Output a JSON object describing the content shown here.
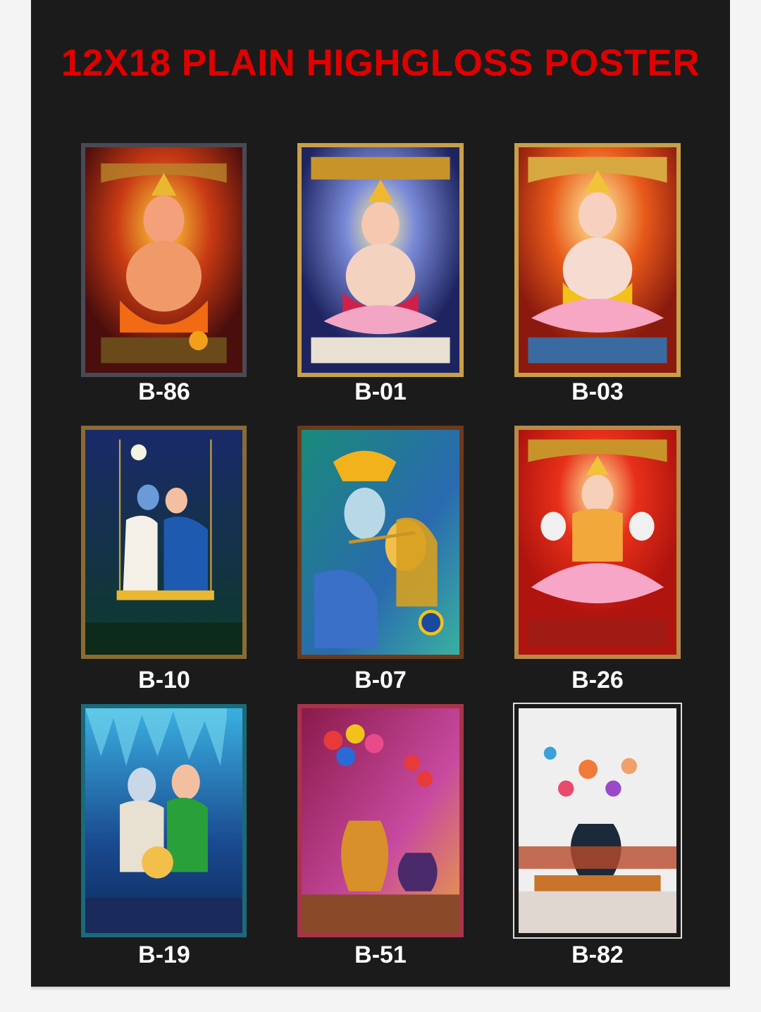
{
  "header": {
    "title": "12X18 PLAIN HIGHGLOSS POSTER"
  },
  "posters": [
    {
      "code": "B-86",
      "subject": "ganesha-icon",
      "bg": "#7a1b14",
      "accent": "#f28c1c",
      "frame": "#4a4a55"
    },
    {
      "code": "B-01",
      "subject": "ganesha-icon",
      "bg": "#2b2f6a",
      "accent": "#e8a21a",
      "frame": "#c8a04a"
    },
    {
      "code": "B-03",
      "subject": "ganesha-icon",
      "bg": "#c8421a",
      "accent": "#f6c84a",
      "frame": "#c8a04a"
    },
    {
      "code": "B-10",
      "subject": "krishna-radha-icon",
      "bg": "#1d2a5c",
      "accent": "#e8b830",
      "frame": "#8a6b32"
    },
    {
      "code": "B-07",
      "subject": "krishna-radha-icon",
      "bg": "#1f7a6a",
      "accent": "#f2b21c",
      "frame": "#6b3a1a"
    },
    {
      "code": "B-26",
      "subject": "lakshmi-icon",
      "bg": "#d0201a",
      "accent": "#f7a6c8",
      "frame": "#b88a4a"
    },
    {
      "code": "B-19",
      "subject": "shiva-family-icon",
      "bg": "#1b5a9a",
      "accent": "#4ac8e8",
      "frame": "#1a6a7a"
    },
    {
      "code": "B-51",
      "subject": "flower-vase-icon",
      "bg": "#7a1a5a",
      "accent": "#e83a3a",
      "frame": "#a8344a"
    },
    {
      "code": "B-82",
      "subject": "flower-vase-icon",
      "bg": "#eeeeee",
      "accent": "#f07a3a",
      "frame": "#1a1a1a"
    }
  ]
}
